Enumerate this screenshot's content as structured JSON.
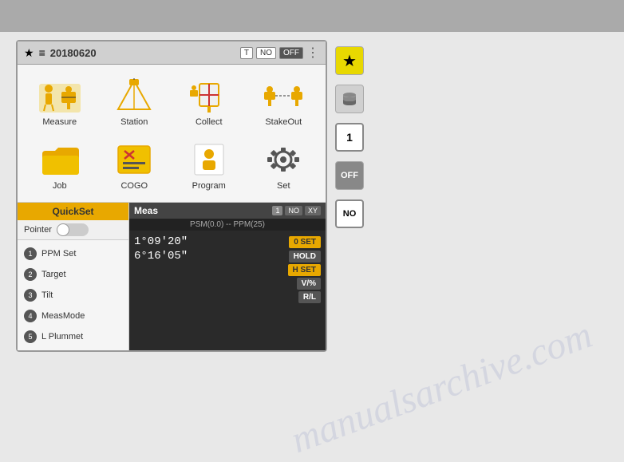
{
  "topbar": {
    "bg": "#aaaaaa"
  },
  "device": {
    "header": {
      "star": "★",
      "db_icon": "≡",
      "date": "20180620",
      "btn_t": "T",
      "btn_no": "NO",
      "btn_off": "OFF",
      "dots": "⋮"
    },
    "icons": [
      {
        "label": "Measure",
        "icon": "measure"
      },
      {
        "label": "Station",
        "icon": "station"
      },
      {
        "label": "Collect",
        "icon": "collect"
      },
      {
        "label": "StakeOut",
        "icon": "stakeout"
      },
      {
        "label": "Job",
        "icon": "job"
      },
      {
        "label": "COGO",
        "icon": "cogo"
      },
      {
        "label": "Program",
        "icon": "program"
      },
      {
        "label": "Set",
        "icon": "set"
      }
    ],
    "quickset": {
      "header": "QuickSet",
      "pointer_label": "Pointer",
      "items": [
        {
          "num": "1",
          "label": "PPM Set"
        },
        {
          "num": "2",
          "label": "Target"
        },
        {
          "num": "3",
          "label": "Tilt"
        },
        {
          "num": "4",
          "label": "MeasMode"
        },
        {
          "num": "5",
          "label": "L Plummet"
        }
      ]
    },
    "meas": {
      "title": "Meas",
      "btn1": "1",
      "btn2": "NO",
      "btn3": "XY",
      "psm": "PSM(0.0) -- PPM(25)",
      "row1_value": "1°09'20\"",
      "row1_btn": "0 SET",
      "row2_value": "6°16'05\"",
      "row2_btn": "HOLD",
      "row3_btn": "H SET",
      "row4_btn": "V/%",
      "row5_btn": "R/L"
    }
  },
  "sidebar": {
    "btn_star": "★",
    "btn_db": "≡",
    "btn_1": "1",
    "btn_off": "OFF",
    "btn_no": "NO"
  },
  "watermark": "manualsarchive.com"
}
